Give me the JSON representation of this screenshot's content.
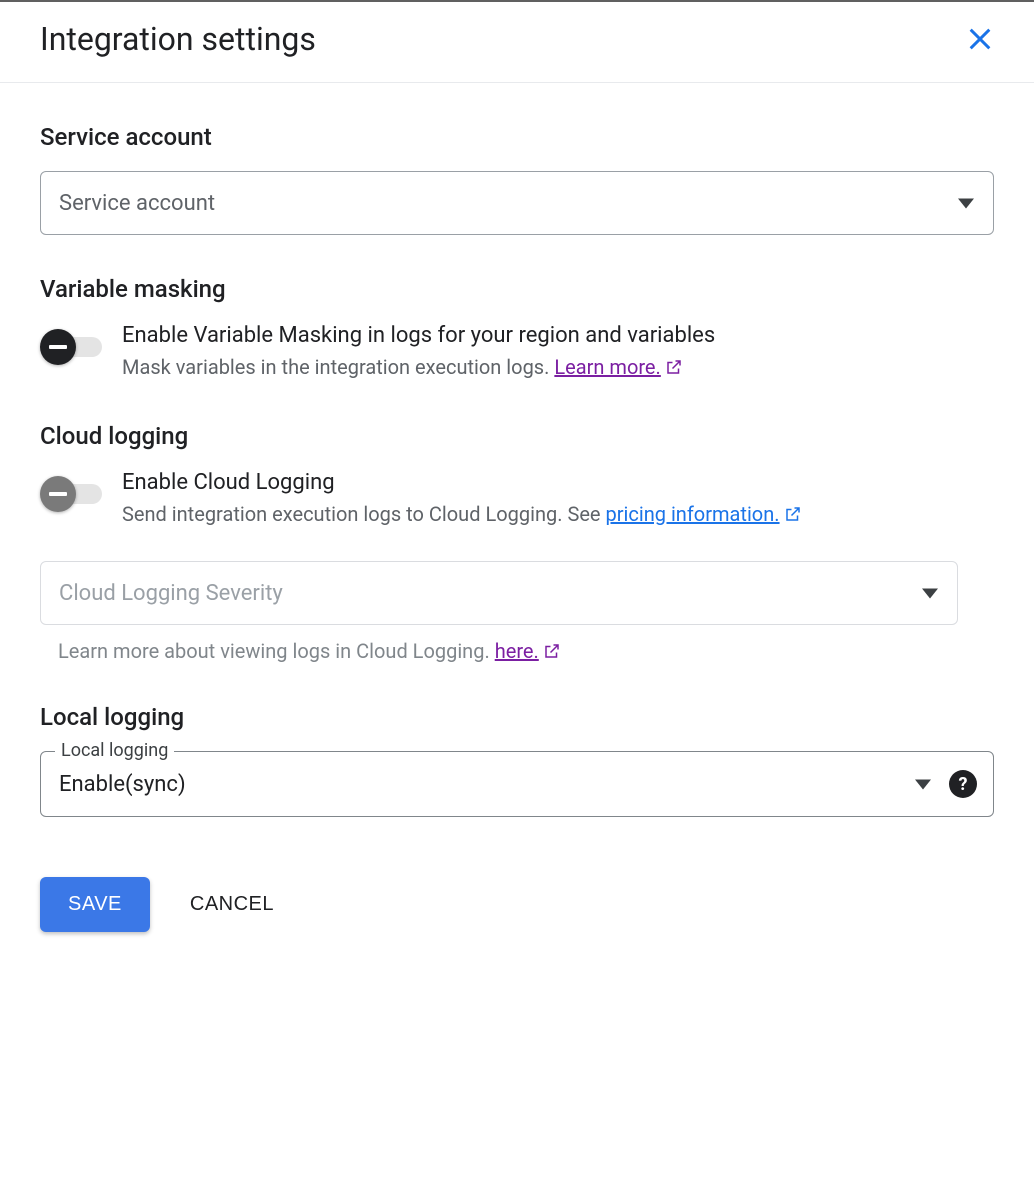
{
  "header": {
    "title": "Integration settings"
  },
  "serviceAccount": {
    "title": "Service account",
    "placeholder": "Service account"
  },
  "variableMasking": {
    "title": "Variable masking",
    "toggleLabel": "Enable Variable Masking in logs for your region and variables",
    "descPrefix": "Mask variables in the integration execution logs. ",
    "learnMore": "Learn more."
  },
  "cloudLogging": {
    "title": "Cloud logging",
    "toggleLabel": "Enable Cloud Logging",
    "descPrefix": "Send integration execution logs to Cloud Logging. See ",
    "pricingLink": "pricing information.",
    "severityPlaceholder": "Cloud Logging Severity",
    "helperPrefix": "Learn more about viewing logs in Cloud Logging. ",
    "helperLink": "here."
  },
  "localLogging": {
    "title": "Local logging",
    "fieldLabel": "Local logging",
    "value": "Enable(sync)"
  },
  "buttons": {
    "save": "SAVE",
    "cancel": "CANCEL"
  }
}
